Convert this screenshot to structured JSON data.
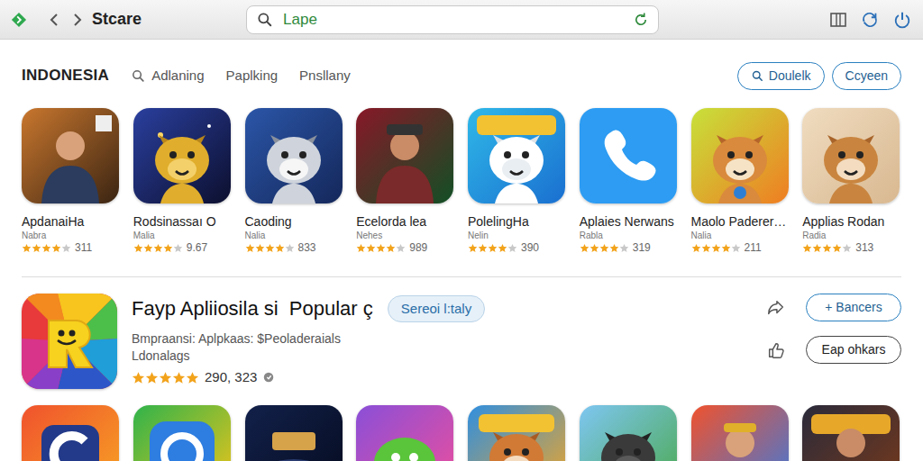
{
  "window": {
    "title": "Stcare"
  },
  "search": {
    "value": "Lape"
  },
  "region": "INDONESIA",
  "filters": [
    {
      "label": "Adlaning",
      "selected": false
    },
    {
      "label": "Paplking",
      "selected": false
    },
    {
      "label": "Pnsllany",
      "selected": false
    }
  ],
  "header_buttons": [
    "Doulelk",
    "Ccyeen"
  ],
  "apps": [
    {
      "name": "ApdanaiHa",
      "developer": "Nabra",
      "rating": "311",
      "stars": 4
    },
    {
      "name": "Rodsinassaı O",
      "developer": "Malia",
      "rating": "9.67",
      "stars": 4
    },
    {
      "name": "Caoding",
      "developer": "Nalia",
      "rating": "833",
      "stars": 4
    },
    {
      "name": "Ecelorda lea",
      "developer": "Nehes",
      "rating": "989",
      "stars": 4
    },
    {
      "name": "PolelingHa",
      "developer": "Nelin",
      "rating": "390",
      "stars": 4
    },
    {
      "name": "Aplaies Nerwans",
      "developer": "Rabla",
      "rating": "319",
      "stars": 4
    },
    {
      "name": "Maolo Paderer…",
      "developer": "Nalia",
      "rating": "211",
      "stars": 4
    },
    {
      "name": "Applias Rodan",
      "developer": "Radia",
      "rating": "313",
      "stars": 4
    }
  ],
  "featured": {
    "title": "Fayp Apliiosila si  Popular ç",
    "tag": "Sereoi l:taly",
    "description": [
      "Bmpraansi: Aplpkaas: $Peoladeraials",
      "Ldonalags"
    ],
    "stars": 5,
    "rating": "290, 323",
    "buttons": [
      "+ Bancers",
      "Eap ohkars"
    ]
  }
}
